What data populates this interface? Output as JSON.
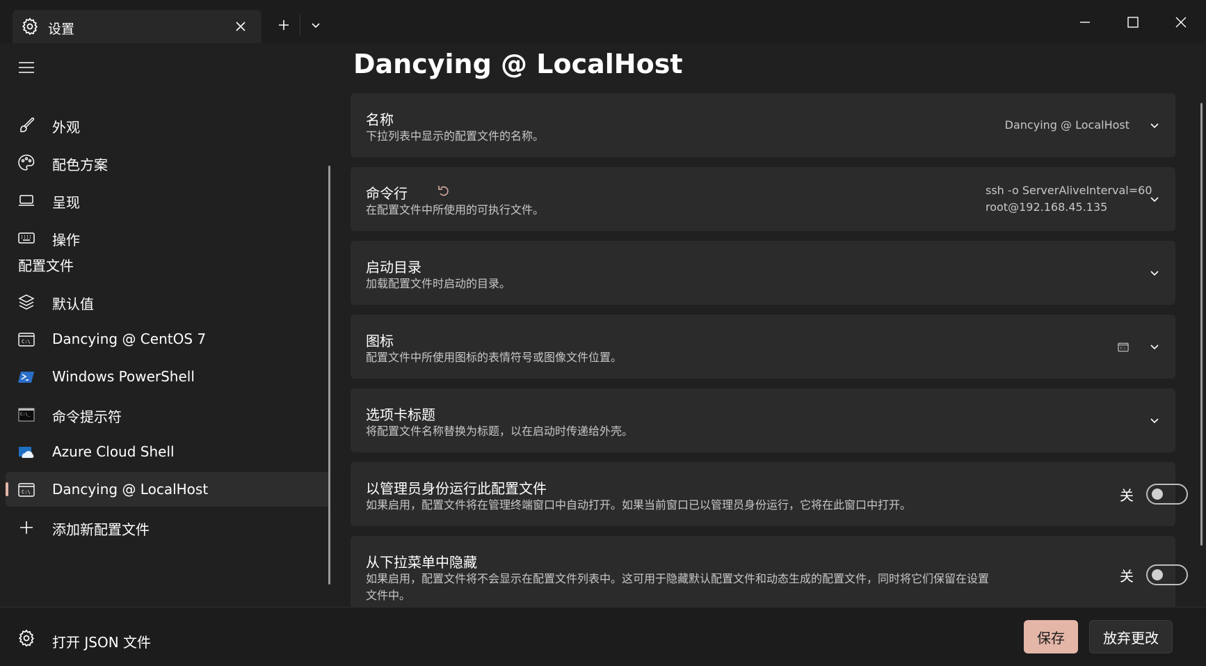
{
  "tab": {
    "title": "设置"
  },
  "sidebar": {
    "items": [
      {
        "label": "外观",
        "icon": "paintbrush-icon"
      },
      {
        "label": "配色方案",
        "icon": "palette-icon"
      },
      {
        "label": "呈现",
        "icon": "laptop-icon"
      },
      {
        "label": "操作",
        "icon": "keyboard-icon"
      }
    ],
    "profiles_header": "配置文件",
    "profiles": [
      {
        "label": "默认值",
        "icon": "layers-icon"
      },
      {
        "label": "Dancying @ CentOS 7",
        "icon": "terminal-icon"
      },
      {
        "label": "Windows PowerShell",
        "icon": "powershell-icon"
      },
      {
        "label": "命令提示符",
        "icon": "cmd-icon"
      },
      {
        "label": "Azure Cloud Shell",
        "icon": "azure-icon"
      },
      {
        "label": "Dancying @ LocalHost",
        "icon": "terminal-icon",
        "selected": true
      },
      {
        "label": "添加新配置文件",
        "icon": "plus-icon"
      }
    ]
  },
  "main": {
    "title": "Dancying @ LocalHost",
    "settings": [
      {
        "title": "名称",
        "description": "下拉列表中显示的配置文件的名称。",
        "value": "Dancying @ LocalHost"
      },
      {
        "title": "命令行",
        "description": "在配置文件中所使用的可执行文件。",
        "value_line1": "ssh -o ServerAliveInterval=60",
        "value_line2": "root@192.168.45.135"
      },
      {
        "title": "启动目录",
        "description": "加载配置文件时启动的目录。"
      },
      {
        "title": "图标",
        "description": "配置文件中所使用图标的表情符号或图像文件位置。"
      },
      {
        "title": "选项卡标题",
        "description": "将配置文件名称替换为标题，以在启动时传递给外壳。"
      },
      {
        "title": "以管理员身份运行此配置文件",
        "description": "如果启用，配置文件将在管理终端窗口中自动打开。如果当前窗口已以管理员身份运行，它将在此窗口中打开。",
        "toggle_label": "关",
        "toggle_on": false
      },
      {
        "title": "从下拉菜单中隐藏",
        "description_line1": "如果启用，配置文件将不会显示在配置文件列表中。这可用于隐藏默认配置文件和动态生成的配置文件，同时将它们保留在设置",
        "description_line2": "文件中。",
        "toggle_label": "关",
        "toggle_on": false
      }
    ]
  },
  "footer": {
    "open_json": "打开 JSON 文件",
    "save": "保存",
    "discard": "放弃更改"
  },
  "colors": {
    "accent": "#e4b6a8",
    "background": "#202020",
    "card": "#2b2b2b"
  }
}
